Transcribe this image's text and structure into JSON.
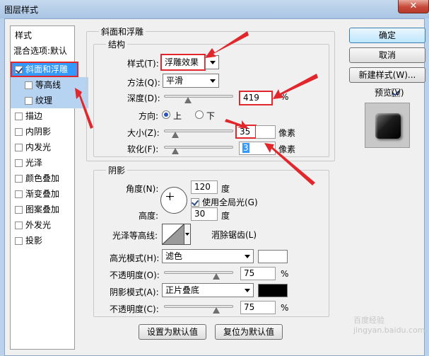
{
  "window": {
    "title": "图层样式",
    "close_glyph": "✕"
  },
  "styles_panel": {
    "header": "样式",
    "blending": "混合选项:默认",
    "items": [
      {
        "label": "斜面和浮雕",
        "checked": true,
        "selected": true
      },
      {
        "label": "等高线",
        "checked": false,
        "sub": true
      },
      {
        "label": "纹理",
        "checked": false,
        "sub": true
      },
      {
        "label": "描边",
        "checked": false
      },
      {
        "label": "内阴影",
        "checked": false
      },
      {
        "label": "内发光",
        "checked": false
      },
      {
        "label": "光泽",
        "checked": false
      },
      {
        "label": "颜色叠加",
        "checked": false
      },
      {
        "label": "渐变叠加",
        "checked": false
      },
      {
        "label": "图案叠加",
        "checked": false
      },
      {
        "label": "外发光",
        "checked": false
      },
      {
        "label": "投影",
        "checked": false
      }
    ]
  },
  "bevel": {
    "group_title": "斜面和浮雕",
    "structure_title": "结构",
    "style_label": "样式(T):",
    "style_value": "浮雕效果",
    "technique_label": "方法(Q):",
    "technique_value": "平滑",
    "depth_label": "深度(D):",
    "depth_value": "419",
    "depth_unit": "%",
    "depth_slider": 0.35,
    "direction_label": "方向:",
    "direction_up": "上",
    "direction_down": "下",
    "size_label": "大小(Z):",
    "size_value": "35",
    "size_unit": "像素",
    "size_slider": 0.16,
    "soften_label": "软化(F):",
    "soften_value": "3",
    "soften_unit": "像素",
    "soften_slider": 0.16
  },
  "shading": {
    "title": "阴影",
    "angle_label": "角度(N):",
    "angle_value": "120",
    "angle_unit": "度",
    "global_light_label": "使用全局光(G)",
    "global_light_checked": true,
    "altitude_label": "高度:",
    "altitude_value": "30",
    "altitude_unit": "度",
    "gloss_contour_label": "光泽等高线:",
    "antialias_label": "消除锯齿(L)",
    "highlight_mode_label": "高光模式(H):",
    "highlight_mode_value": "滤色",
    "highlight_color": "#ffffff",
    "highlight_opacity_label": "不透明度(O):",
    "highlight_opacity_value": "75",
    "highlight_opacity_slider": 0.75,
    "shadow_mode_label": "阴影模式(A):",
    "shadow_mode_value": "正片叠底",
    "shadow_color": "#000000",
    "shadow_opacity_label": "不透明度(C):",
    "shadow_opacity_value": "75",
    "shadow_opacity_slider": 0.75,
    "percent_unit": "%"
  },
  "footer": {
    "make_default": "设置为默认值",
    "reset_default": "复位为默认值"
  },
  "right": {
    "ok": "确定",
    "cancel": "取消",
    "new_style": "新建样式(W)...",
    "preview_label": "预览(V)",
    "preview_checked": true
  },
  "watermark": "百度经验 jingyan.baidu.com",
  "colors": {
    "selection": "#3399ff",
    "annotation": "#e1262c"
  }
}
